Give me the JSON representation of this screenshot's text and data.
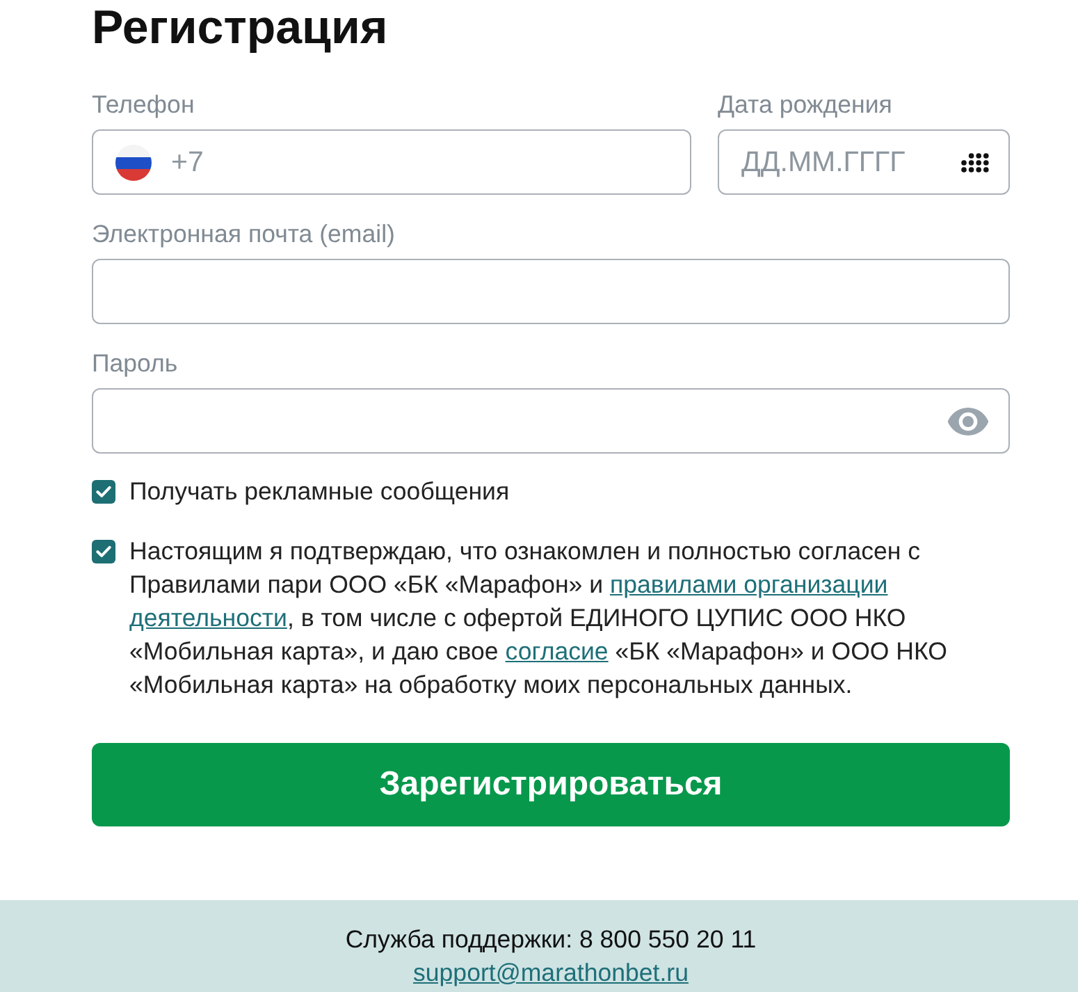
{
  "title": "Регистрация",
  "field_rows": [
    {
      "fields": [
        {
          "kind": "phone",
          "label": "Телефон",
          "placeholder": "+7"
        },
        {
          "kind": "date",
          "label": "Дата рождения",
          "placeholder": "ДД.ММ.ГГГГ"
        }
      ]
    },
    {
      "fields": [
        {
          "kind": "email",
          "label": "Электронная почта (email)"
        }
      ]
    },
    {
      "fields": [
        {
          "kind": "password",
          "label": "Пароль"
        }
      ]
    }
  ],
  "checkboxes": [
    {
      "checked": true,
      "segments": [
        {
          "kind": "text",
          "text": "Получать рекламные сообщения"
        }
      ]
    },
    {
      "checked": true,
      "segments": [
        {
          "kind": "text",
          "text": "Настоящим я подтверждаю, что ознакомлен и полностью согласен с Правилами пари ООО «БК «Марафон» и "
        },
        {
          "kind": "link",
          "text": "правилами организации"
        },
        {
          "kind": "link",
          "text": "деятельности"
        },
        {
          "kind": "text",
          "text": ", в том числе с офертой ЕДИНОГО ЦУПИС ООО НКО «Мобильная карта», и даю свое "
        },
        {
          "kind": "link",
          "text": "согласие"
        },
        {
          "kind": "text",
          "text": " «БК «Марафон» и ООО НКО «Мобильная карта» на обработку моих персональных данных."
        }
      ]
    }
  ],
  "submit_button": "Зарегистрироваться",
  "footer": {
    "support": "Служба поддержки: 8 800 550 20 11",
    "email_link": "support@marathonbet.ru"
  }
}
